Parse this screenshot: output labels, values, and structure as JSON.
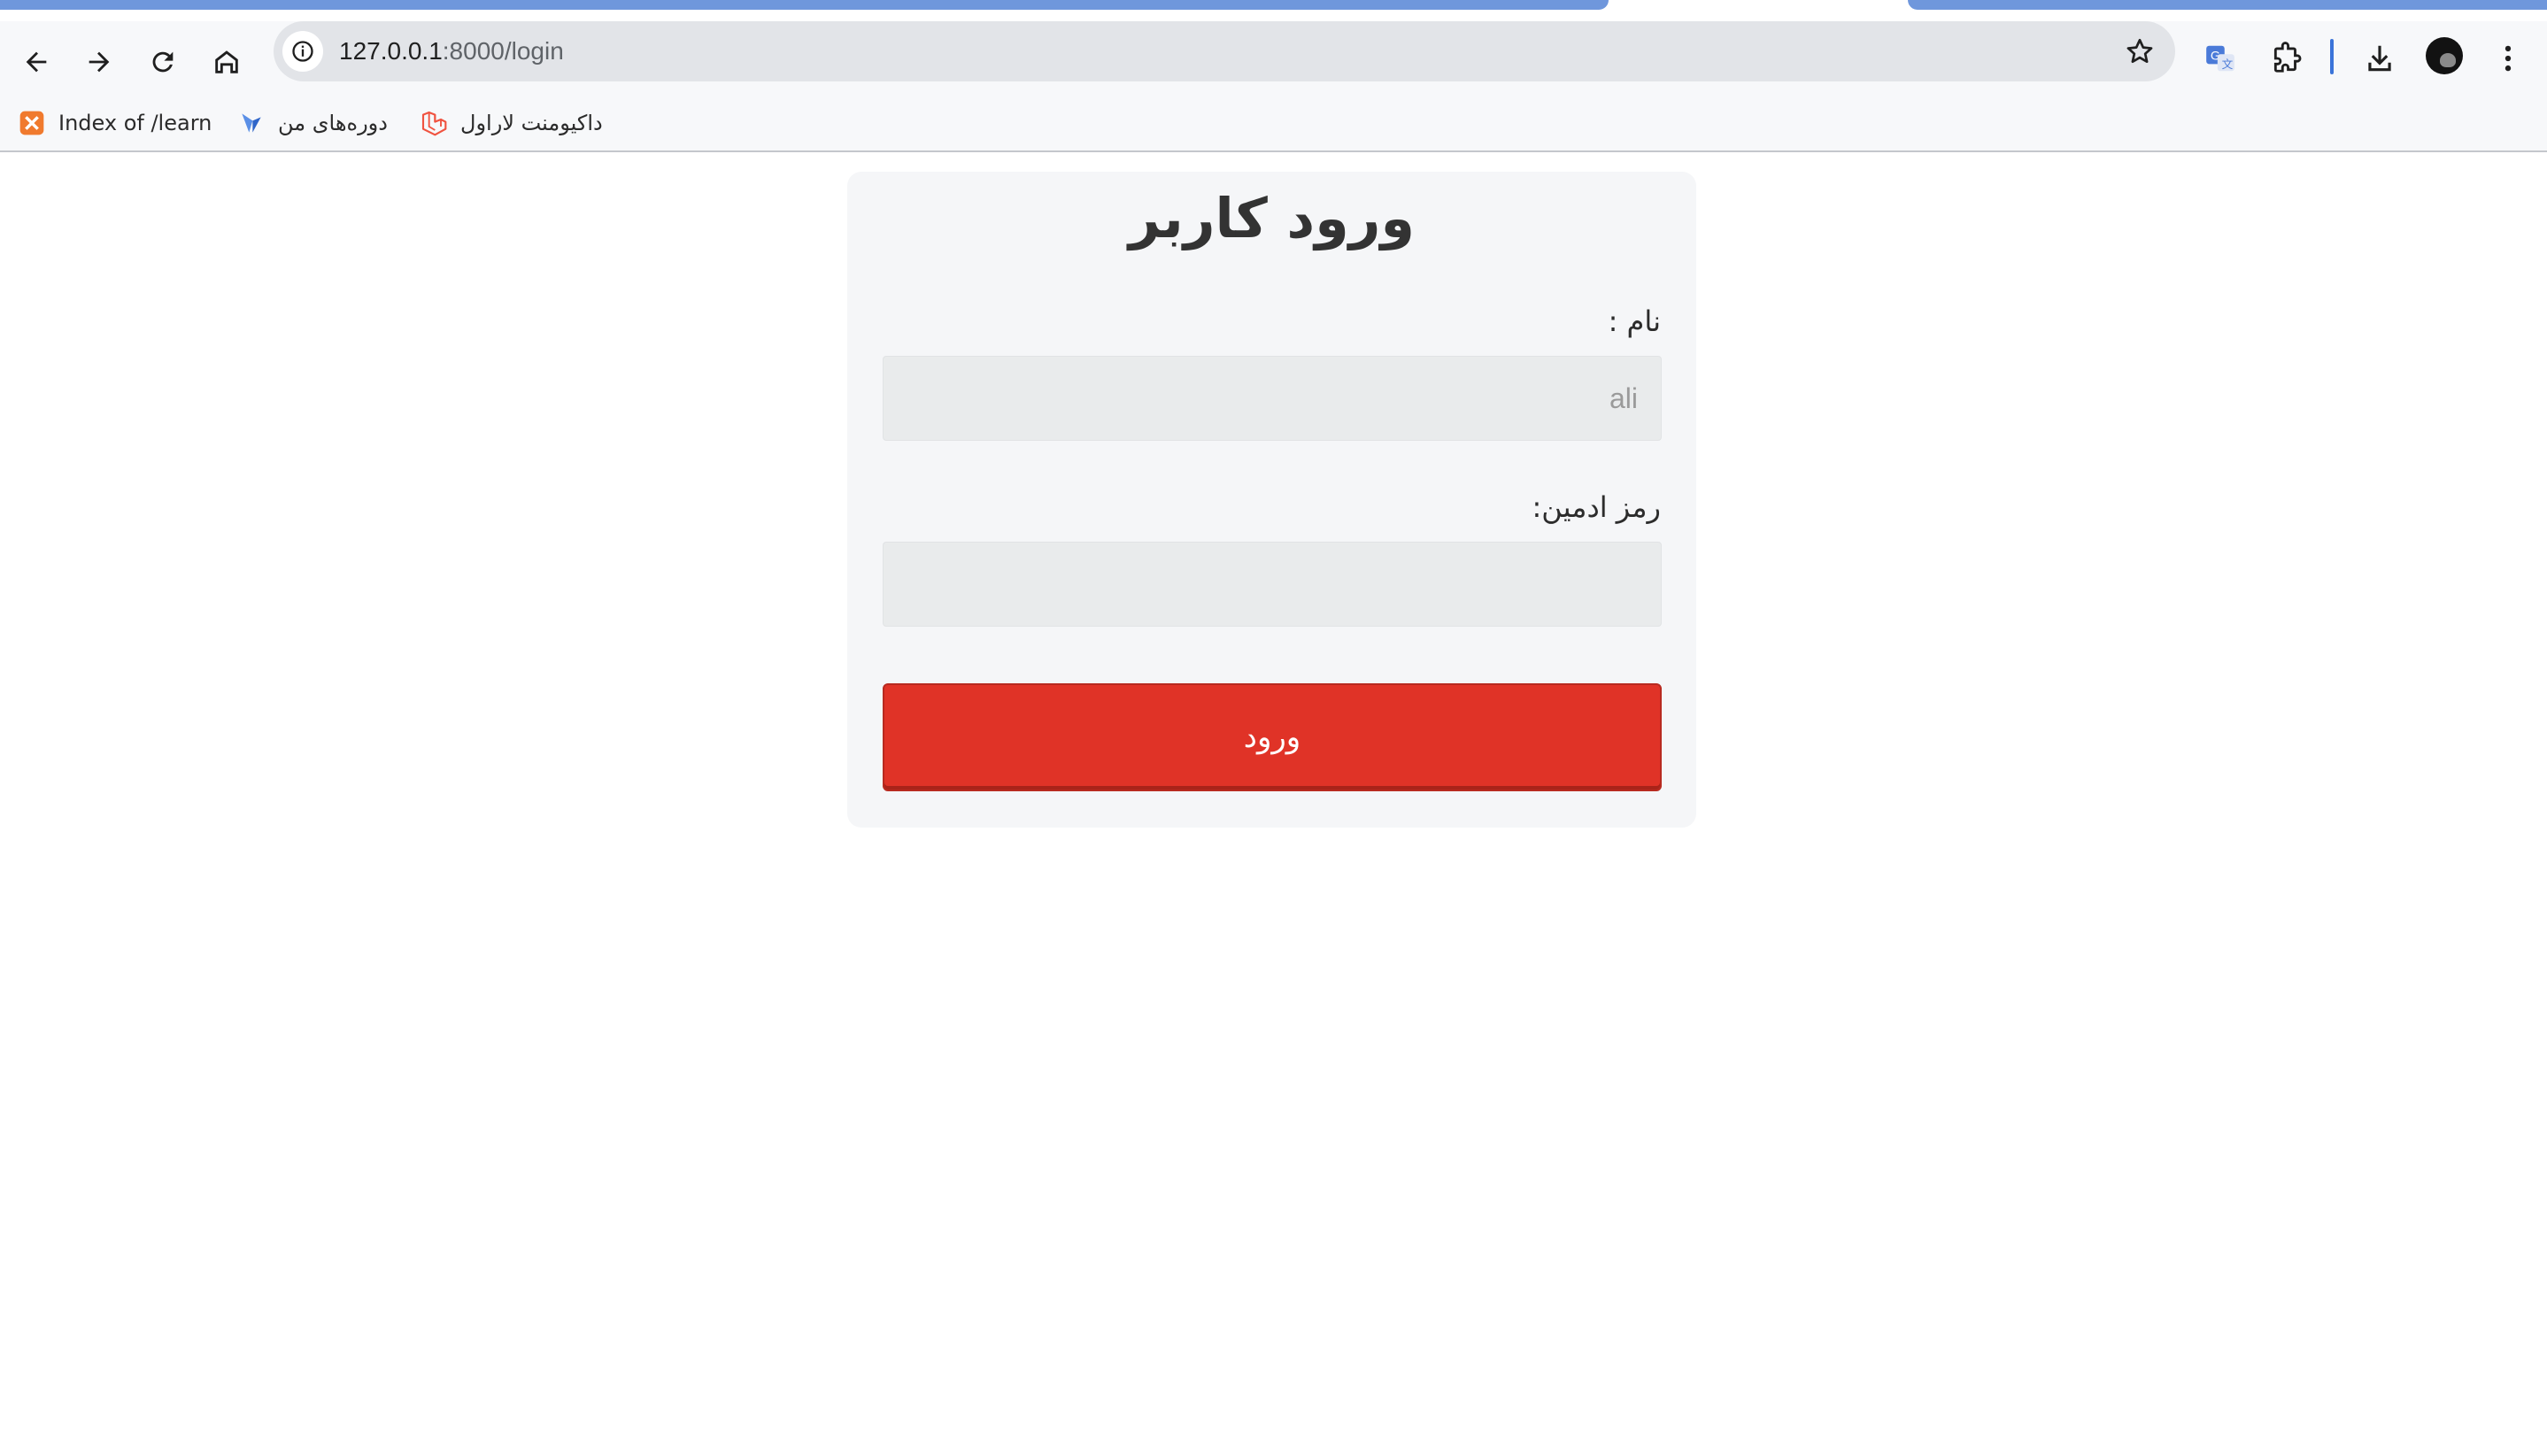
{
  "browser": {
    "url_host": "127.0.0.1",
    "url_path": ":8000/login",
    "accent_color": "#6f97dc"
  },
  "bookmarks": [
    {
      "label": "Index of /learn",
      "icon": "xampp-icon"
    },
    {
      "label": "دوره‌های من",
      "icon": "course-logo-icon"
    },
    {
      "label": "داکیومنت لاراول",
      "icon": "laravel-icon"
    }
  ],
  "login": {
    "title": "ورود کاربر",
    "name_label": "نام :",
    "name_placeholder": "ali",
    "password_label": "رمز ادمین:",
    "password_value": "",
    "submit_label": "ورود",
    "submit_color": "#e03327"
  }
}
